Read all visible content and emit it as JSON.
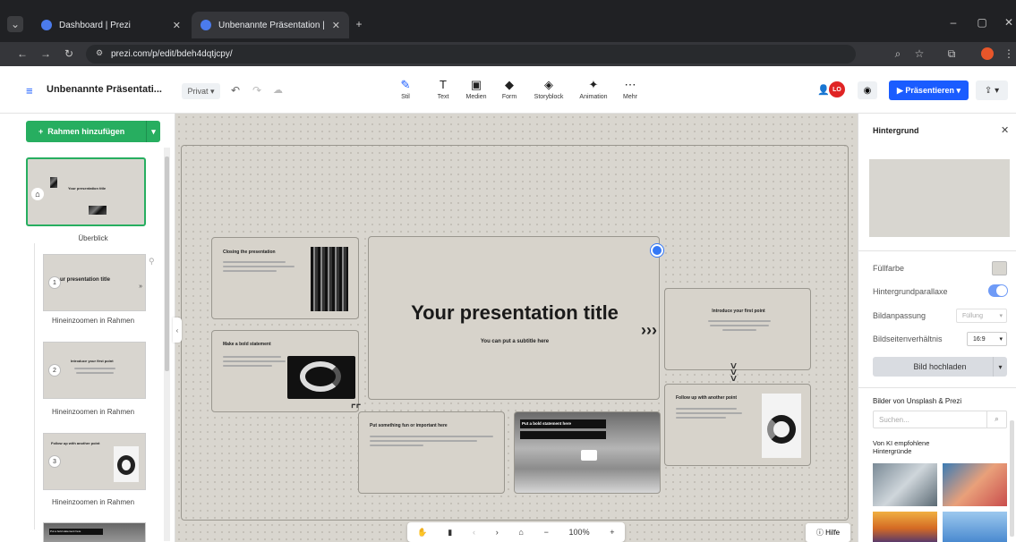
{
  "browser": {
    "tabs": [
      {
        "label": "Dashboard | Prezi"
      },
      {
        "label": "Unbenannte Präsentation | Prezi"
      }
    ],
    "url": "prezi.com/p/edit/bdeh4dqtjcpy/"
  },
  "app": {
    "doc_title": "Unbenannte Präsentati...",
    "privacy": "Privat",
    "present_label": "Präsentieren",
    "avatar_initials": "LO",
    "tools": [
      {
        "label": "Stil",
        "icon": "pen-icon"
      },
      {
        "label": "Text",
        "icon": "text-icon"
      },
      {
        "label": "Medien",
        "icon": "image-icon"
      },
      {
        "label": "Form",
        "icon": "shapes-icon"
      },
      {
        "label": "Storyblock",
        "icon": "layers-icon"
      },
      {
        "label": "Animation",
        "icon": "magic-wand-icon"
      },
      {
        "label": "Mehr",
        "icon": "more-icon"
      }
    ]
  },
  "left": {
    "add_frame": "Rahmen hinzufügen",
    "overview_label": "Überblick",
    "items": [
      {
        "num": "1",
        "title": "ur presentation title",
        "caption": "Hineinzoomen in Rahmen"
      },
      {
        "num": "2",
        "title": "Introduce your first point",
        "caption": "Hineinzoomen in Rahmen"
      },
      {
        "num": "3",
        "title": "Follow up with another point",
        "caption": "Hineinzoomen in Rahmen"
      },
      {
        "title": "Put a bold statement here"
      }
    ]
  },
  "canvas": {
    "main_title": "Your presentation title",
    "main_subtitle": "You can put a subtitle here",
    "frames": {
      "closing": "Closing the presentation",
      "bold": "Make a bold statement",
      "fun": "Put something fun or important here",
      "statement": "Put a bold statement here",
      "intro": "Introduce your first point",
      "follow": "Follow up with another point"
    },
    "overview_thumb_title": "Your presentation title"
  },
  "right": {
    "title": "Hintergrund",
    "fill": "Füllfarbe",
    "parallax": "Hintergrundparallaxe",
    "fit_label": "Bildanpassung",
    "fit_value": "Füllung",
    "ratio_label": "Bildseitenverhältnis",
    "ratio_value": "16:9",
    "upload": "Bild hochladen",
    "unsplash": "Bilder von Unsplash & Prezi",
    "search_placeholder": "Suchen...",
    "ai_label": "Von KI empfohlene Hintergründe"
  },
  "bottom": {
    "zoom": "100%",
    "help": "Hilfe"
  },
  "colors": {
    "accent": "#1a5cff",
    "green": "#27ae60"
  }
}
